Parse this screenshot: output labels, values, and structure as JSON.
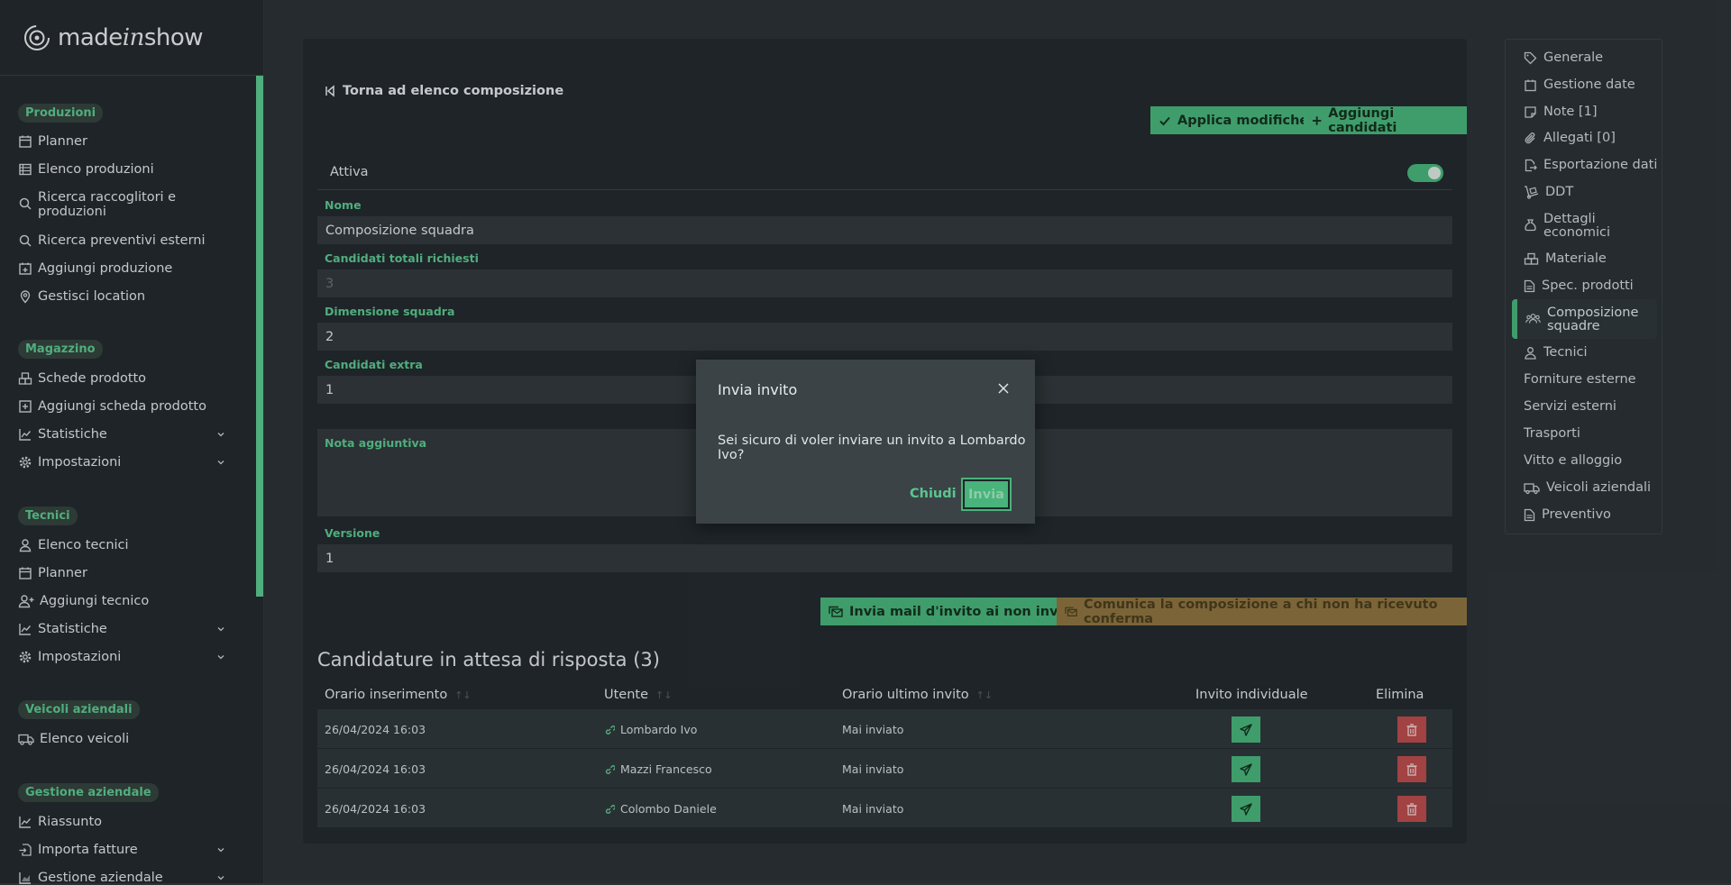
{
  "brand": {
    "name_a": "made",
    "name_b": "in",
    "name_c": "show"
  },
  "sidebar": {
    "sections": [
      {
        "title": "Produzioni",
        "items": [
          {
            "label": "Planner",
            "icon": "calendar-icon"
          },
          {
            "label": "Elenco produzioni",
            "icon": "list-icon"
          },
          {
            "label": "Ricerca raccoglitori e produzioni",
            "icon": "search-icon"
          },
          {
            "label": "Ricerca preventivi esterni",
            "icon": "search-icon"
          },
          {
            "label": "Aggiungi produzione",
            "icon": "calendar-plus-icon"
          },
          {
            "label": "Gestisci location",
            "icon": "location-pin-icon"
          }
        ]
      },
      {
        "title": "Magazzino",
        "items": [
          {
            "label": "Schede prodotto",
            "icon": "boxes-icon"
          },
          {
            "label": "Aggiungi scheda prodotto",
            "icon": "plus-square-icon"
          },
          {
            "label": "Statistiche",
            "icon": "chart-line-icon"
          },
          {
            "label": "Impostazioni",
            "icon": "gear-icon"
          }
        ]
      },
      {
        "title": "Tecnici",
        "items": [
          {
            "label": "Elenco tecnici",
            "icon": "user-icon"
          },
          {
            "label": "Planner",
            "icon": "calendar-icon"
          },
          {
            "label": "Aggiungi tecnico",
            "icon": "user-plus-icon"
          },
          {
            "label": "Statistiche",
            "icon": "chart-line-icon"
          },
          {
            "label": "Impostazioni",
            "icon": "gear-icon"
          }
        ]
      },
      {
        "title": "Veicoli aziendali",
        "items": [
          {
            "label": "Elenco veicoli",
            "icon": "truck-icon"
          }
        ]
      },
      {
        "title": "Gestione aziendale",
        "items": [
          {
            "label": "Riassunto",
            "icon": "chart-line-icon"
          },
          {
            "label": "Importa fatture",
            "icon": "file-import-icon"
          },
          {
            "label": "Gestione aziendale",
            "icon": "chart-area-icon"
          }
        ]
      }
    ]
  },
  "main": {
    "back_label": "Torna ad elenco composizione",
    "apply_label": "Applica modifiche",
    "add_candidates_label": "Aggiungi candidati",
    "active_label": "Attiva",
    "active_on": true,
    "fields": {
      "nome_label": "Nome",
      "nome_value": "Composizione squadra",
      "candidati_label": "Candidati totali richiesti",
      "candidati_value": "3",
      "dimensione_label": "Dimensione squadra",
      "dimensione_value": "2",
      "extra_label": "Candidati extra",
      "extra_value": "1",
      "nota_label": "Nota aggiuntiva",
      "versione_label": "Versione",
      "versione_value": "1"
    },
    "invite_all_label": "Invia mail d'invito ai non invitati",
    "notify_label": "Comunica la composizione a chi non ha ricevuto conferma",
    "table": {
      "title": "Candidature in attesa di risposta (3)",
      "headers": [
        "Orario inserimento",
        "Utente",
        "Orario ultimo invito",
        "Invito individuale",
        "Elimina"
      ],
      "rows": [
        {
          "inserted": "26/04/2024 16:03",
          "user": "Lombardo Ivo",
          "last_invite": "Mai inviato"
        },
        {
          "inserted": "26/04/2024 16:03",
          "user": "Mazzi Francesco",
          "last_invite": "Mai inviato"
        },
        {
          "inserted": "26/04/2024 16:03",
          "user": "Colombo Daniele",
          "last_invite": "Mai inviato"
        }
      ]
    }
  },
  "right_nav": {
    "items": [
      "Generale",
      "Gestione date",
      "Note [1]",
      "Allegati [0]",
      "Esportazione dati",
      "DDT",
      "Dettagli economici",
      "Materiale",
      "Spec. prodotti",
      "Composizione squadre",
      "Tecnici",
      "Forniture esterne",
      "Servizi esterni",
      "Trasporti",
      "Vitto e alloggio",
      "Veicoli aziendali",
      "Preventivo"
    ],
    "active": "Composizione squadre"
  },
  "modal": {
    "title": "Invia invito",
    "message": "Sei sicuro di voler inviare un invito a Lombardo Ivo?",
    "cancel_label": "Chiudi",
    "confirm_label": "Invia"
  },
  "colors": {
    "accent": "#48b37a",
    "danger": "#b94c4c",
    "warning": "#8c7440"
  }
}
